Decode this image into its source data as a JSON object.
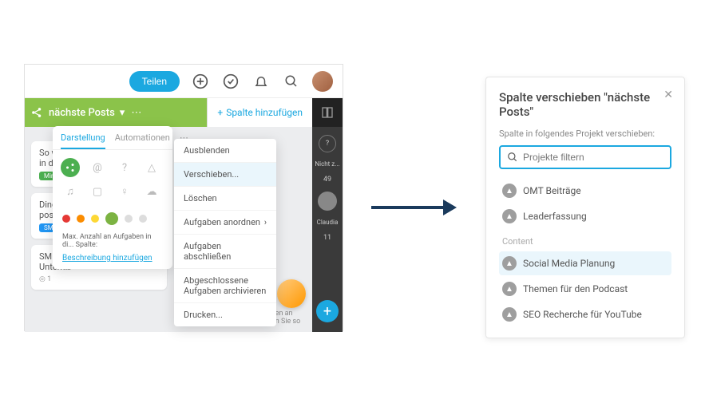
{
  "topbar": {
    "share_label": "Teilen",
    "add_icon": "plus-circle",
    "check_icon": "check-circle",
    "bell_icon": "bell",
    "search_icon": "search"
  },
  "column": {
    "name": "nächste Posts",
    "add_label": "Spalte hinzufügen"
  },
  "cards": [
    {
      "title": "So wir…",
      "title2": "in dei…",
      "tag": "Mindset",
      "tag_color": "green"
    },
    {
      "title": "Dinge,",
      "title2": "poster…",
      "tag": "SM All",
      "tag_color": "blue"
    },
    {
      "title": "SM St…",
      "title2": "Untern…",
      "count": "◎ 1"
    }
  ],
  "popover": {
    "tabs": {
      "display": "Darstellung",
      "automation": "Automationen"
    },
    "max_text": "Max. Anzahl an Aufgaben in di... Spalte:",
    "desc_link": "Beschreibung hinzufügen",
    "colors": [
      "#e53935",
      "#fb8c00",
      "#fdd835",
      "#7cb342",
      "#bdbdbd",
      "#bdbdbd"
    ]
  },
  "ctx": {
    "hide": "Ausblenden",
    "move": "Verschieben...",
    "delete": "Löschen",
    "arrange": "Aufgaben anordnen",
    "complete": "Aufgaben abschließen",
    "archive": "Abgeschlossene Aufgaben archivieren",
    "print": "Drucken..."
  },
  "dark_sidebar": {
    "help_label": "?",
    "user1": {
      "name": "Nicht z...",
      "count": "49"
    },
    "user2": {
      "name": "Claudia",
      "count": "11"
    }
  },
  "forget_text": "Freunden und Kollegen an Projekten und werden Sie so",
  "modal": {
    "title": "Spalte verschieben \"nächste Posts\"",
    "subtitle": "Spalte in folgendes Projekt verschieben:",
    "filter_placeholder": "Projekte filtern",
    "group1": [
      {
        "name": "OMT Beiträge"
      },
      {
        "name": "Leaderfassung"
      }
    ],
    "group2_label": "Content",
    "group2": [
      {
        "name": "Social Media Planung",
        "selected": true
      },
      {
        "name": "Themen für den Podcast"
      },
      {
        "name": "SEO Recherche für YouTube"
      }
    ]
  }
}
